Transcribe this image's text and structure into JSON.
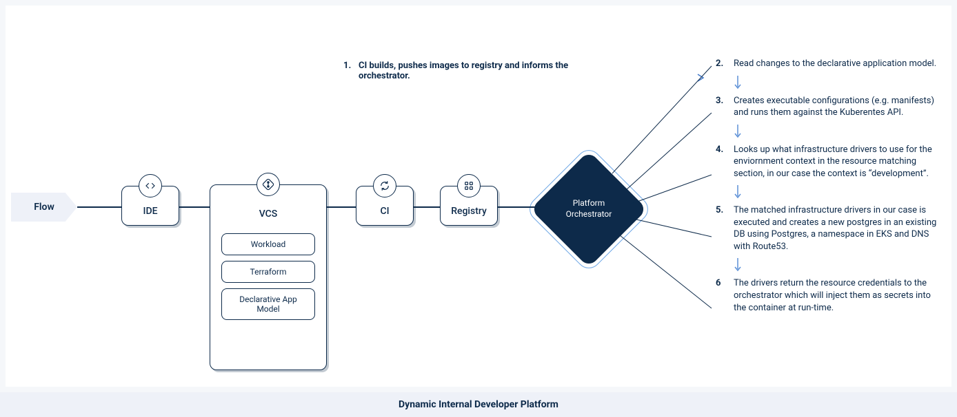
{
  "flowLabel": "Flow",
  "nodes": {
    "ide": {
      "label": "IDE"
    },
    "vcs": {
      "label": "VCS"
    },
    "ci": {
      "label": "CI"
    },
    "registry": {
      "label": "Registry"
    }
  },
  "vcsItems": [
    "Workload",
    "Terraform",
    "Declarative App Model"
  ],
  "orchestrator": "Platform Orchestrator",
  "topAnnotation": {
    "num": "1.",
    "text": "CI builds, pushes images to registry and informs the orchestrator."
  },
  "steps": [
    {
      "num": "2.",
      "text": "Read changes to the declarative application model."
    },
    {
      "num": "3.",
      "text": "Creates executable configurations (e.g. manifests) and runs them against the Kuberentes API."
    },
    {
      "num": "4.",
      "text": "Looks up what infrastructure drivers to use for the enviornment context in the resource matching section, in our case the context is “development”."
    },
    {
      "num": "5.",
      "text": "The matched infrastructure drivers in our case is executed and creates a new postgres in an existing DB using Postgres, a namespace in EKS and DNS with Route53."
    },
    {
      "num": "6",
      "text": "The drivers return the resource credentials to the orchestrator which will inject them as secrets into the container at run-time."
    }
  ],
  "footer": "Dynamic Internal Developer Platform"
}
